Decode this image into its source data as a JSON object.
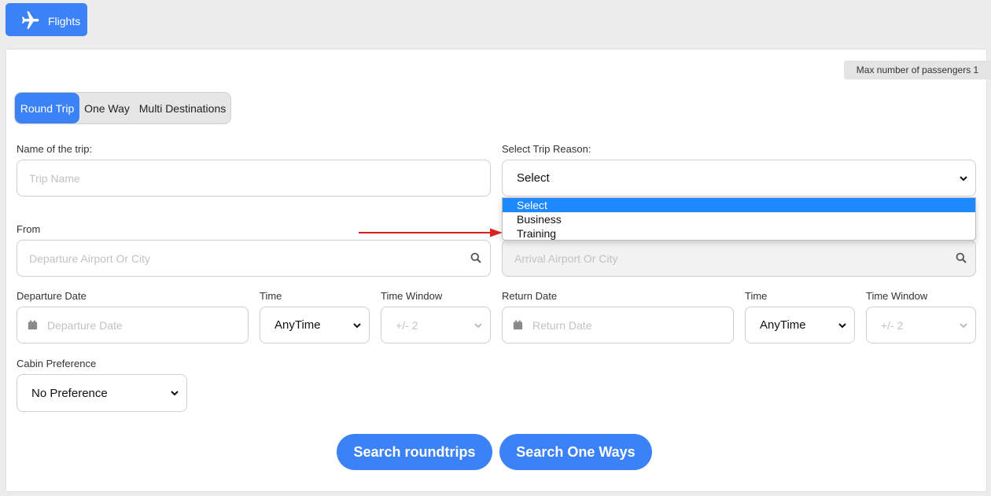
{
  "tab": {
    "label": "Flights",
    "icon": "airplane-icon"
  },
  "max_passengers": "Max number of passengers 1",
  "trip_types": [
    {
      "label": "Round Trip",
      "active": true
    },
    {
      "label": "One Way",
      "active": false
    },
    {
      "label": "Multi Destinations",
      "active": false
    }
  ],
  "trip_name": {
    "label": "Name of the trip:",
    "placeholder": "Trip Name"
  },
  "trip_reason": {
    "label": "Select Trip Reason:",
    "value": "Select",
    "options": [
      "Select",
      "Business",
      "Training"
    ],
    "selected_option": "Select"
  },
  "from": {
    "label": "From",
    "placeholder": "Departure Airport Or City"
  },
  "to": {
    "placeholder": "Arrival Airport Or City"
  },
  "departure": {
    "date_label": "Departure Date",
    "date_placeholder": "Departure Date",
    "time_label": "Time",
    "time_value": "AnyTime",
    "window_label": "Time Window",
    "window_value": "+/- 2"
  },
  "return": {
    "date_label": "Return Date",
    "date_placeholder": "Return Date",
    "time_label": "Time",
    "time_value": "AnyTime",
    "window_label": "Time Window",
    "window_value": "+/- 2"
  },
  "cabin": {
    "label": "Cabin Preference",
    "value": "No Preference"
  },
  "actions": {
    "search_roundtrips": "Search roundtrips",
    "search_one_ways": "Search One Ways"
  },
  "colors": {
    "accent": "#3b82f6",
    "dropdown_highlight": "#1e88ff",
    "annotation_arrow": "#e0201f"
  }
}
